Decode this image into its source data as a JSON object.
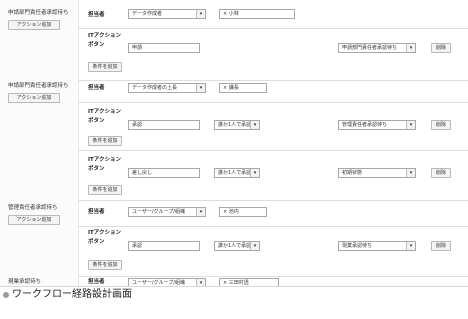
{
  "steps": [
    {
      "step_label": "申請部門責任者承認待ち",
      "add_action_label": "アクション追加",
      "assignee_label": "担当者",
      "assignee_select": "データ作成者",
      "assignee_value": "× 小林",
      "action_label_line1": "ITアクション",
      "action_label_line2": "ボタン",
      "action_name": "申請",
      "next_status": "申請部門責任者承認待ち",
      "delete_label": "削除",
      "add_condition_label": "条件を追加"
    },
    {
      "step_label": "申請部門責任者承認待ち",
      "add_action_label": "アクション追加",
      "assignee_label": "担当者",
      "assignee_select": "データ作成者の上長",
      "assignee_value": "× 課長",
      "actions": [
        {
          "action_label_line1": "ITアクション",
          "action_label_line2": "ボタン",
          "action_name": "承認",
          "condition_select": "誰か1人で承認",
          "next_status": "管理責任者承認待ち",
          "delete_label": "削除",
          "add_condition_label": "条件を追加"
        },
        {
          "action_label_line1": "ITアクション",
          "action_label_line2": "ボタン",
          "action_name": "差し戻し",
          "condition_select": "誰か1人で承認",
          "next_status": "初期状態",
          "delete_label": "削除",
          "add_condition_label": "条件を追加"
        }
      ]
    },
    {
      "step_label": "管理責任者承認待ち",
      "add_action_label": "アクション追加",
      "assignee_label": "担当者",
      "assignee_select": "ユーザー/グループ/組織",
      "assignee_value": "× 池内",
      "action_label_line1": "ITアクション",
      "action_label_line2": "ボタン",
      "action_name": "承認",
      "condition_select": "誰か1人で承認",
      "next_status": "現業承認待ち",
      "delete_label": "削除",
      "add_condition_label": "条件を追加"
    },
    {
      "step_label": "現業承認待ち",
      "assignee_label": "担当者",
      "assignee_select": "ユーザー/グループ/組織",
      "assignee_value": "× 三田村透"
    }
  ],
  "caption": "ワークフロー経路設計画面",
  "icons": {
    "dropdown": "chevron-down-icon",
    "remove": "remove-x-icon",
    "bullet": "bullet-icon"
  }
}
